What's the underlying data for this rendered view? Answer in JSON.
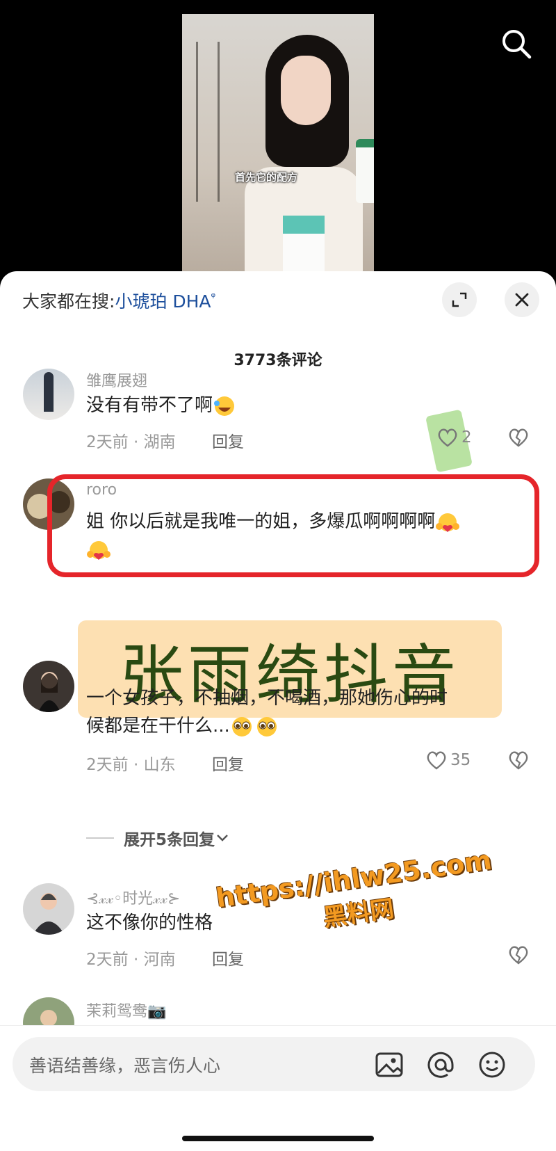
{
  "video": {
    "caption": "首先它的配方"
  },
  "panel": {
    "people_search_prefix": "大家都在搜:",
    "people_search_term": "小琥珀 DHA",
    "comment_count": "3773条评论"
  },
  "comments": [
    {
      "name": "雏鹰展翅",
      "text": "没有有带不了啊",
      "time_loc": "2天前 · 湖南",
      "reply": "回复",
      "likes": "2"
    },
    {
      "name": "roro",
      "text_line1": "姐 你以后就是我唯一的姐，多爆瓜啊啊啊啊"
    },
    {
      "name": "",
      "text_line1": "一个女孩子，不抽烟，不喝酒，那她伤心的时",
      "text_line2": "候都是在干什么...",
      "time_loc": "2天前 · 山东",
      "reply": "回复",
      "likes": "35"
    },
    {
      "name": "⊰𝓍𝓍◦时光𝓍𝓍⊱",
      "text": "这不像你的性格",
      "time_loc": "2天前 · 河南",
      "reply": "回复"
    },
    {
      "name": "茉莉鸳鸯📷"
    }
  ],
  "expand_replies": "展开5条回复",
  "overlay_banner": "张雨绮抖音",
  "watermark": {
    "url": "https://ihlw25.com",
    "label": "黑料网"
  },
  "input": {
    "placeholder": "善语结善缘，恶言伤人心"
  },
  "colors": {
    "accent": "#1d4f9c",
    "highlight": "#e5252a",
    "banner_bg": "#fde0b2"
  }
}
